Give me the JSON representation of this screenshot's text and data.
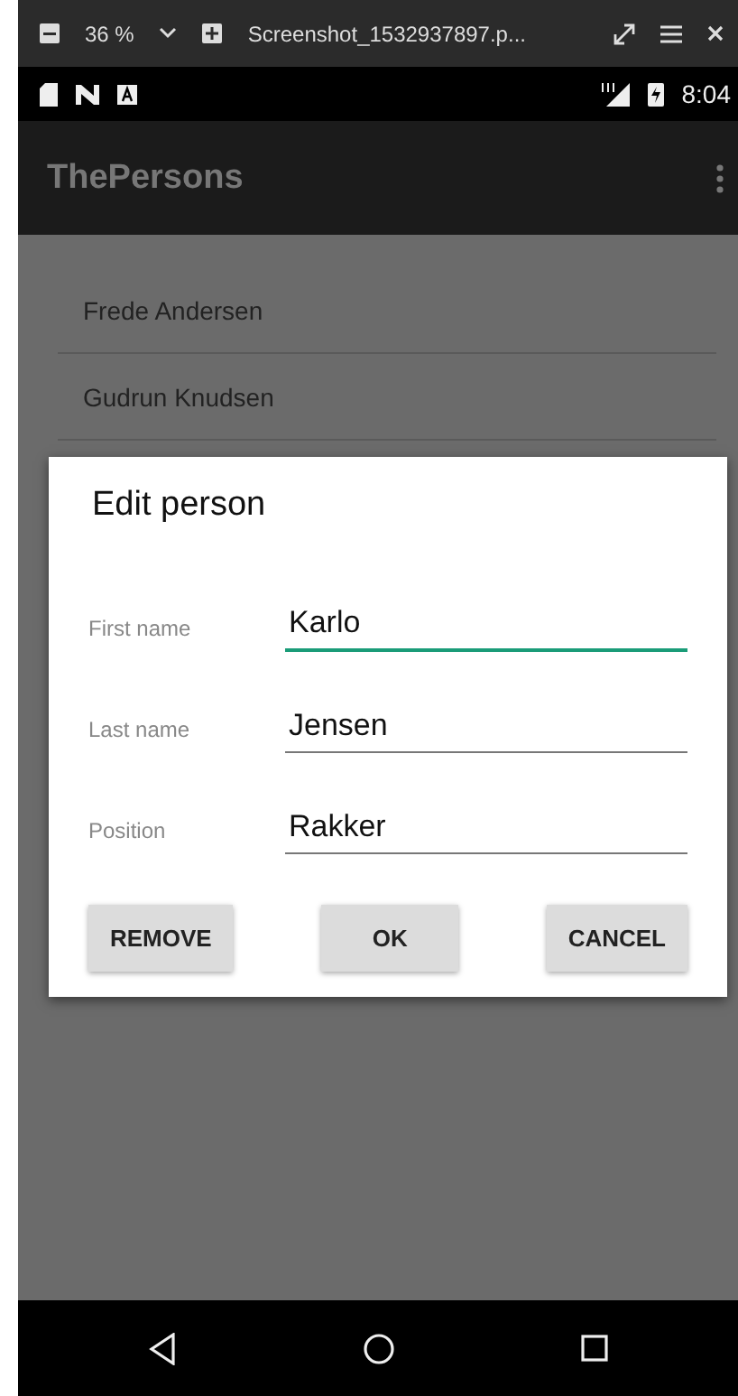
{
  "viewer": {
    "zoom": "36 %",
    "filename": "Screenshot_1532937897.p..."
  },
  "status_bar": {
    "time": "8:04"
  },
  "app_bar": {
    "title": "ThePersons"
  },
  "persons": [
    "Frede Andersen",
    "Gudrun Knudsen"
  ],
  "dialog": {
    "title": "Edit person",
    "fields": [
      {
        "label": "First name",
        "value": "Karlo",
        "focused": true
      },
      {
        "label": "Last name",
        "value": "Jensen",
        "focused": false
      },
      {
        "label": "Position",
        "value": "Rakker",
        "focused": false
      }
    ],
    "buttons": [
      "REMOVE",
      "OK",
      "CANCEL"
    ]
  }
}
